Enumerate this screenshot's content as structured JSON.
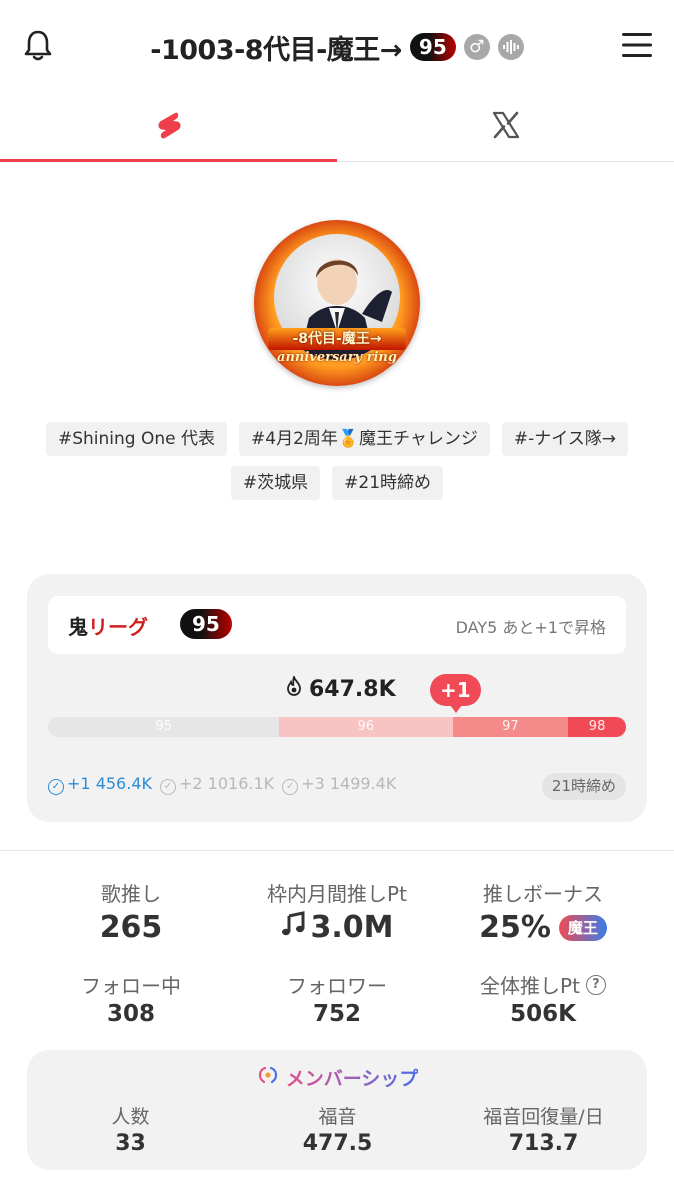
{
  "header": {
    "title": "-1003-8代目-魔王→",
    "level": "95",
    "gender_symbol": "♂",
    "icons": [
      "bell-icon",
      "male-icon",
      "voice-icon",
      "menu-icon"
    ]
  },
  "tabs": [
    {
      "name": "shorts",
      "icon": "red-s-logo-icon",
      "active": true
    },
    {
      "name": "x",
      "icon": "x-logo-icon",
      "active": false
    }
  ],
  "avatar": {
    "ring_text": "-8代目-魔王→",
    "ring_subtext": "anniversary ring"
  },
  "tags": [
    "#Shining One 代表",
    "#4月2周年🏅魔王チャレンジ",
    "#-ナイス隊→",
    "#茨城県",
    "#21時締め"
  ],
  "league": {
    "name_prefix": "鬼",
    "name_suffix": "リーグ",
    "level": "95",
    "day_text": "DAY5 あと+1で昇格",
    "score": "647.8K",
    "rank_change": "+1",
    "bar": [
      {
        "label": "95",
        "fraction": 0.4,
        "color": "#e6e6e6"
      },
      {
        "label": "96",
        "fraction": 0.3,
        "color": "#f7c3c3"
      },
      {
        "label": "97",
        "fraction": 0.2,
        "color": "#f58a8a"
      },
      {
        "label": "98",
        "fraction": 0.1,
        "color": "#ef4a55"
      }
    ],
    "thresholds": [
      {
        "label": "+1",
        "value": "456.4K",
        "active": true
      },
      {
        "label": "+2",
        "value": "1016.1K",
        "active": false
      },
      {
        "label": "+3",
        "value": "1499.4K",
        "active": false
      }
    ],
    "deadline": "21時締め"
  },
  "stats": {
    "uta": {
      "label": "歌推し",
      "value": "265"
    },
    "monthly": {
      "label": "枠内月間推しPt",
      "value": "3.0M",
      "icon": "music-note-icon"
    },
    "bonus": {
      "label": "推しボーナス",
      "value": "25%",
      "badge": "魔王"
    },
    "following": {
      "label": "フォロー中",
      "value": "308"
    },
    "followers": {
      "label": "フォロワー",
      "value": "752"
    },
    "total": {
      "label": "全体推しPt",
      "value": "506K",
      "help": "?"
    }
  },
  "membership": {
    "title": "メンバーシップ",
    "count": {
      "label": "人数",
      "value": "33"
    },
    "gospel": {
      "label": "福音",
      "value": "477.5"
    },
    "recovery": {
      "label": "福音回復量/日",
      "value": "713.7"
    }
  }
}
